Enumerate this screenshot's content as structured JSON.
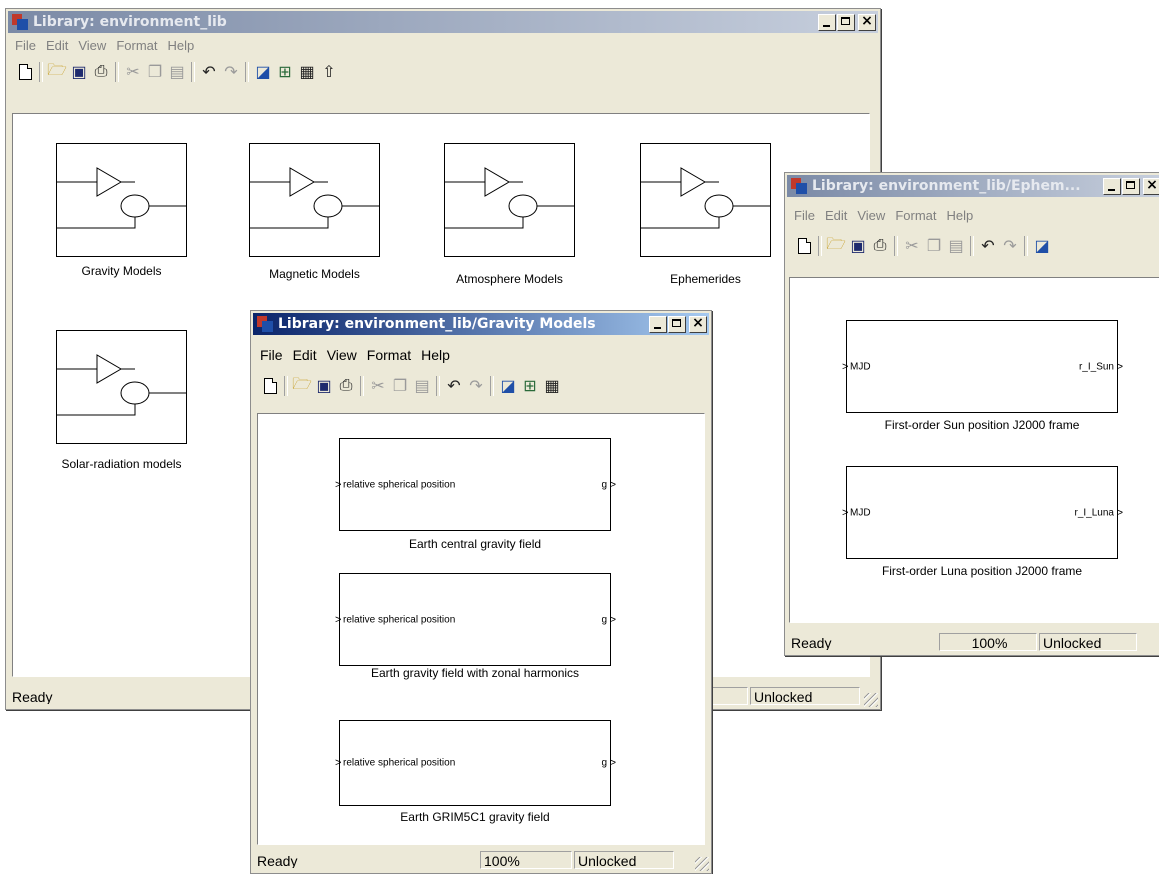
{
  "main_window": {
    "title": "Library: environment_lib",
    "menu": [
      "File",
      "Edit",
      "View",
      "Format",
      "Help"
    ],
    "blocks": [
      {
        "label": "Gravity Models"
      },
      {
        "label": "Magnetic Models"
      },
      {
        "label": "Atmosphere Models"
      },
      {
        "label": "Ephemerides"
      },
      {
        "label": "Solar-radiation models"
      }
    ],
    "status": {
      "ready": "Ready",
      "lock": "Unlocked"
    }
  },
  "ephem_window": {
    "title": "Library: environment_lib/Ephem...",
    "menu": [
      "File",
      "Edit",
      "View",
      "Format",
      "Help"
    ],
    "blocks": [
      {
        "input": "MJD",
        "output": "r_I_Sun",
        "label": "First-order Sun position J2000 frame"
      },
      {
        "input": "MJD",
        "output": "r_I_Luna",
        "label": "First-order Luna position J2000 frame"
      }
    ],
    "status": {
      "ready": "Ready",
      "zoom": "100%",
      "lock": "Unlocked"
    }
  },
  "gravity_window": {
    "title": "Library: environment_lib/Gravity Models",
    "menu": [
      "File",
      "Edit",
      "View",
      "Format",
      "Help"
    ],
    "blocks": [
      {
        "input": "relative spherical position",
        "output": "g",
        "label": "Earth central gravity field"
      },
      {
        "input": "relative spherical position",
        "output": "g",
        "label": "Earth gravity field with zonal harmonics"
      },
      {
        "input": "relative spherical position",
        "output": "g",
        "label": "Earth GRIM5C1 gravity field"
      }
    ],
    "status": {
      "ready": "Ready",
      "zoom": "100%",
      "lock": "Unlocked"
    }
  },
  "toolbar_icons": [
    "new-model-icon",
    "open-folder-icon",
    "save-icon",
    "print-icon",
    "cut-icon",
    "copy-icon",
    "paste-icon",
    "undo-icon",
    "redo-icon",
    "library-browser-icon",
    "model-explorer-icon",
    "debugger-icon",
    "go-to-parent-icon"
  ],
  "colors": {
    "window_bg": "#ece9d8",
    "active_title": "#0a246a",
    "inactive_title": "#7b8aa6"
  }
}
